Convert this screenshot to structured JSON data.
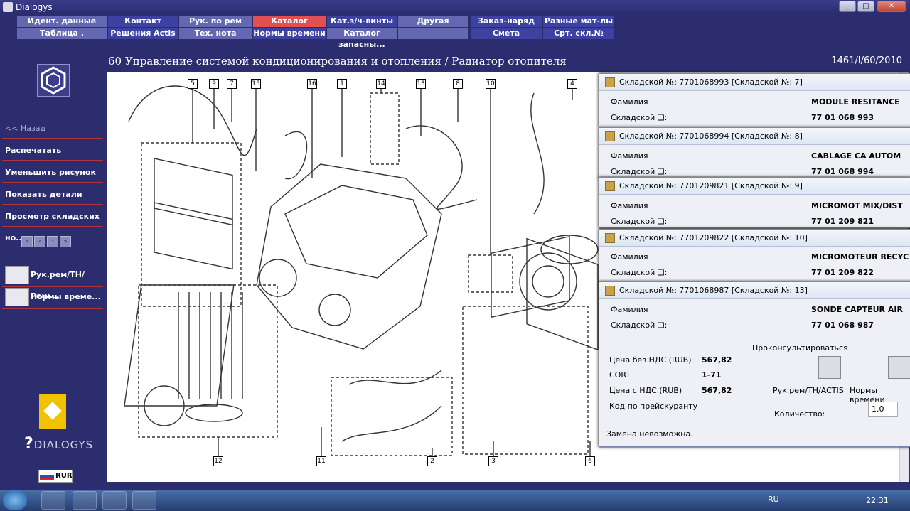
{
  "window": {
    "title": "Dialogys",
    "subtitle": "...",
    "min": "_",
    "max": "□",
    "close": "✕"
  },
  "menu_row1": [
    "Идент. данные",
    "Контакт",
    "Рук. по рем",
    "Каталог запчастей",
    "Кат.з/ч-винты",
    "Другая",
    "Заказ-наряд",
    "Разные мат-лы"
  ],
  "menu_row2": [
    "Таблица .",
    "Решения Actis",
    "Тех. нота",
    "Нормы времени",
    "Каталог запасны...",
    "",
    "Смета",
    "Срт. скл.№"
  ],
  "header": {
    "title": "60 Управление системой кондиционирования и отопления / Радиатор отопителя",
    "ref": "1461/I/60/2010"
  },
  "sidebar": {
    "back": "<< Назад",
    "items": [
      "Распечатать",
      "Уменьшить рисунок",
      "Показать детали",
      "Просмотр складских но..."
    ],
    "tools": [
      "Рук.рем/ТН/Реш....",
      "Нормы време..."
    ],
    "brand": "DIALOGYS",
    "currency": "RUR"
  },
  "callouts": [
    "5",
    "9",
    "7",
    "15",
    "16",
    "1",
    "14",
    "13",
    "8",
    "10",
    "4",
    "12",
    "11",
    "2",
    "3",
    "6"
  ],
  "popups": [
    {
      "title": "Складской №: 7701068993 [Складской №: 7]",
      "name_label": "Фамилия",
      "name": "MODULE RESITANCE",
      "stock_label": "Складской ❏:",
      "stock": "77 01 068 993"
    },
    {
      "title": "Складской №: 7701068994 [Складской №: 8]",
      "name_label": "Фамилия",
      "name": "CABLAGE CA AUTOM",
      "stock_label": "Складской ❏:",
      "stock": "77 01 068 994"
    },
    {
      "title": "Складской №: 7701209821 [Складской №: 9]",
      "name_label": "Фамилия",
      "name": "MICROMOT MIX/DIST",
      "stock_label": "Складской ❏:",
      "stock": "77 01 209 821"
    },
    {
      "title": "Складской №: 7701209822 [Складской №: 10]",
      "name_label": "Фамилия",
      "name": "MICROMOTEUR RECYC",
      "stock_label": "Складской ❏:",
      "stock": "77 01 209 822"
    },
    {
      "title": "Складской №: 7701068987 [Складской №: 13]",
      "name_label": "Фамилия",
      "name": "SONDE CAPTEUR AIR",
      "stock_label": "Складской ❏:",
      "stock": "77 01 068 987"
    }
  ],
  "details": {
    "price_no_vat_label": "Цена без НДС (RUB)",
    "price_no_vat": "567,82",
    "cort_label": "CORT",
    "cort": "1-71",
    "price_vat_label": "Цена с НДС (RUB)",
    "price_vat": "567,82",
    "price_code_label": "Код по прейскуранту",
    "consult_label": "Проконсультироваться",
    "tool1": "Рук.рем/TH/ACTIS",
    "tool2": "Нормы времени",
    "qty_label": "Количество:",
    "qty": "1.0",
    "replace_note": "Замена невозможна."
  },
  "taskbar": {
    "lang": "RU",
    "time": "22:31"
  }
}
